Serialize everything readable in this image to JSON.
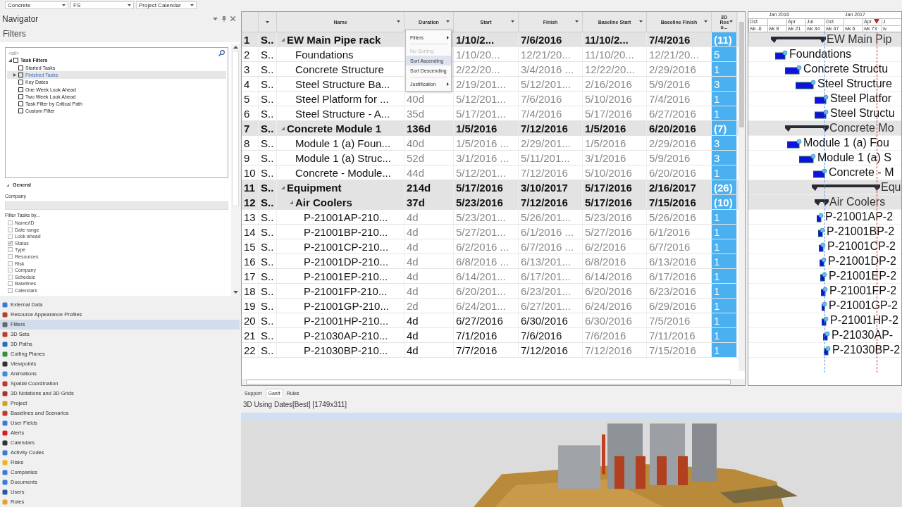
{
  "toolbar": {
    "dropdowns": [
      "Concrete",
      "FS",
      "Project Calendar"
    ]
  },
  "navigator": {
    "title": "Navigator",
    "section": "Filters",
    "filter_tree": {
      "placeholder": "<all>",
      "root": {
        "label": "Task Filters",
        "expanded": true,
        "checked": false,
        "children": [
          {
            "label": "Started Tasks",
            "checked": false,
            "selected": false
          },
          {
            "label": "Finished Tasks",
            "checked": false,
            "selected": true,
            "expanded": false
          },
          {
            "label": "Key Dates",
            "checked": false,
            "selected": false
          },
          {
            "label": "One Week Look Ahead",
            "checked": false,
            "selected": false
          },
          {
            "label": "Two Week Look Ahead",
            "checked": false,
            "selected": false
          },
          {
            "label": "Task Filter by Critical Path",
            "checked": false,
            "selected": false
          },
          {
            "label": "Custom Filter",
            "checked": false,
            "selected": false
          }
        ]
      }
    },
    "general": {
      "title": "General",
      "expanded": true,
      "company_label": "Company",
      "filter_by_label": "Filter Tasks by...",
      "options": [
        {
          "label": "Name/ID",
          "checked": false
        },
        {
          "label": "Date range",
          "checked": false
        },
        {
          "label": "Look ahead",
          "checked": false
        },
        {
          "label": "Status",
          "checked": true
        },
        {
          "label": "Type",
          "checked": false
        },
        {
          "label": "Resources",
          "checked": false
        },
        {
          "label": "Risk",
          "checked": false
        },
        {
          "label": "Company",
          "checked": false
        },
        {
          "label": "Schedule",
          "checked": false
        },
        {
          "label": "Baselines",
          "checked": false
        },
        {
          "label": "Calendars",
          "checked": false
        }
      ]
    },
    "items": [
      {
        "label": "External Data",
        "selected": false
      },
      {
        "label": "Resource Appearance Profiles",
        "selected": false
      },
      {
        "label": "Filters",
        "selected": true
      },
      {
        "label": "3D Sets",
        "selected": false
      },
      {
        "label": "3D Paths",
        "selected": false
      },
      {
        "label": "Cutting Planes",
        "selected": false
      },
      {
        "label": "Viewpoints",
        "selected": false
      },
      {
        "label": "Animations",
        "selected": false
      },
      {
        "label": "Spatial Coordination",
        "selected": false
      },
      {
        "label": "3D Notations and 3D Grids",
        "selected": false
      },
      {
        "label": "Project",
        "selected": false
      },
      {
        "label": "Baselines and Scenarios",
        "selected": false
      },
      {
        "label": "User Fields",
        "selected": false
      },
      {
        "label": "Alerts",
        "selected": false
      },
      {
        "label": "Calendars",
        "selected": false
      },
      {
        "label": "Activity Codes",
        "selected": false
      },
      {
        "label": "Risks",
        "selected": false
      },
      {
        "label": "Companies",
        "selected": false
      },
      {
        "label": "Documents",
        "selected": false
      },
      {
        "label": "Users",
        "selected": false
      },
      {
        "label": "Roles",
        "selected": false
      }
    ]
  },
  "table": {
    "columns": [
      "Name",
      "Duration",
      "Start",
      "Finish",
      "Baseline Start",
      "Baseline Finish",
      "3D Res o..."
    ],
    "rows": [
      {
        "kind": "summary",
        "number": "1",
        "code": "S..",
        "name": "EW Main Pipe rack",
        "start": "1/10/2...",
        "finish": "7/6/2016",
        "baseline_start": "11/10/2...",
        "baseline_finish": "7/4/2016",
        "resources": "(11)",
        "gantt_label": "EW Main Pip",
        "expanded": true,
        "children": [
          {
            "kind": "task",
            "dimmed": true,
            "number": "2",
            "code": "S..",
            "name": "Foundations",
            "start": "1/10/20...",
            "finish": "12/21/20...",
            "baseline_start": "11/10/20...",
            "baseline_finish": "12/21/20...",
            "resources": "5",
            "gantt_label": "Foundations"
          },
          {
            "kind": "task",
            "dimmed": true,
            "number": "3",
            "code": "S..",
            "name": "Concrete Structure",
            "start": "2/22/20...",
            "finish": "3/4/2016 ...",
            "baseline_start": "12/22/20...",
            "baseline_finish": "2/29/2016",
            "resources": "1",
            "gantt_label": "Concrete Structu"
          },
          {
            "kind": "task",
            "dimmed": true,
            "number": "4",
            "code": "S..",
            "name": "Steel Structure Ba...",
            "start": "2/19/201...",
            "finish": "5/12/201...",
            "baseline_start": "2/16/2016",
            "baseline_finish": "5/9/2016",
            "resources": "3",
            "gantt_label": "Steel Structure"
          },
          {
            "kind": "task",
            "dimmed": true,
            "number": "5",
            "code": "S..",
            "name": "Steel Platform for ...",
            "duration": "40d",
            "start": "5/12/201...",
            "finish": "7/6/2016",
            "baseline_start": "5/10/2016",
            "baseline_finish": "7/4/2016",
            "resources": "1",
            "gantt_label": "Steel Platfor"
          },
          {
            "kind": "task",
            "dimmed": true,
            "number": "6",
            "code": "S..",
            "name": "Steel Structure - A...",
            "duration": "35d",
            "start": "5/17/201...",
            "finish": "7/4/2016",
            "baseline_start": "5/17/2016",
            "baseline_finish": "6/27/2016",
            "resources": "1",
            "gantt_label": "Steel Structu"
          }
        ]
      },
      {
        "kind": "summary",
        "number": "7",
        "code": "S..",
        "name": "Concrete Module 1",
        "duration": "136d",
        "start": "1/5/2016",
        "finish": "7/12/2016",
        "baseline_start": "1/5/2016",
        "baseline_finish": "6/20/2016",
        "resources": "(7)",
        "gantt_label": "Concrete Mo",
        "expanded": true,
        "children": [
          {
            "kind": "task",
            "dimmed": true,
            "number": "8",
            "code": "S..",
            "name": "Module 1 (a) Foun...",
            "duration": "40d",
            "start": "1/5/2016 ...",
            "finish": "2/29/201...",
            "baseline_start": "1/5/2016",
            "baseline_finish": "2/29/2016",
            "resources": "3",
            "gantt_label": "Module 1 (a) Fou"
          },
          {
            "kind": "task",
            "dimmed": true,
            "number": "9",
            "code": "S..",
            "name": "Module 1 (a) Struc...",
            "duration": "52d",
            "start": "3/1/2016 ...",
            "finish": "5/11/201...",
            "baseline_start": "3/1/2016",
            "baseline_finish": "5/9/2016",
            "resources": "3",
            "gantt_label": "Module 1 (a) S"
          },
          {
            "kind": "task",
            "dimmed": true,
            "number": "10",
            "code": "S..",
            "name": "Concrete - Module...",
            "duration": "44d",
            "start": "5/12/201...",
            "finish": "7/12/2016",
            "baseline_start": "5/10/2016",
            "baseline_finish": "6/20/2016",
            "resources": "1",
            "gantt_label": "Concrete - M"
          }
        ]
      },
      {
        "kind": "summary",
        "number": "11",
        "code": "S..",
        "name": "Equipment",
        "duration": "214d",
        "start": "5/17/2016",
        "finish": "3/10/2017",
        "baseline_start": "5/17/2016",
        "baseline_finish": "2/16/2017",
        "resources": "(26)",
        "gantt_label": "Equ",
        "expanded": true,
        "children": [
          {
            "kind": "summary",
            "number": "12",
            "code": "S..",
            "name": "Air Coolers",
            "duration": "37d",
            "start": "5/23/2016",
            "finish": "7/12/2016",
            "baseline_start": "5/17/2016",
            "baseline_finish": "7/15/2016",
            "resources": "(10)",
            "gantt_label": "Air Coolers",
            "expanded": true,
            "children": [
              {
                "kind": "task",
                "dimmed": true,
                "number": "13",
                "code": "S..",
                "name": "P-21001AP-210...",
                "duration": "4d",
                "start": "5/23/201...",
                "finish": "5/26/201...",
                "baseline_start": "5/23/2016",
                "baseline_finish": "5/26/2016",
                "resources": "1",
                "gantt_label": "P-21001AP-2"
              },
              {
                "kind": "task",
                "dimmed": true,
                "number": "14",
                "code": "S..",
                "name": "P-21001BP-210...",
                "duration": "4d",
                "start": "5/27/201...",
                "finish": "6/1/2016 ...",
                "baseline_start": "5/27/2016",
                "baseline_finish": "6/1/2016",
                "resources": "1",
                "gantt_label": "P-21001BP-2"
              },
              {
                "kind": "task",
                "dimmed": true,
                "number": "15",
                "code": "S..",
                "name": "P-21001CP-210...",
                "duration": "4d",
                "start": "6/2/2016 ...",
                "finish": "6/7/2016 ...",
                "baseline_start": "6/2/2016",
                "baseline_finish": "6/7/2016",
                "resources": "1",
                "gantt_label": "P-21001CP-2"
              },
              {
                "kind": "task",
                "dimmed": true,
                "number": "16",
                "code": "S..",
                "name": "P-21001DP-210...",
                "duration": "4d",
                "start": "6/8/2016 ...",
                "finish": "6/13/201...",
                "baseline_start": "6/8/2016",
                "baseline_finish": "6/13/2016",
                "resources": "1",
                "gantt_label": "P-21001DP-2"
              },
              {
                "kind": "task",
                "dimmed": true,
                "number": "17",
                "code": "S..",
                "name": "P-21001EP-210...",
                "duration": "4d",
                "start": "6/14/201...",
                "finish": "6/17/201...",
                "baseline_start": "6/14/2016",
                "baseline_finish": "6/17/2016",
                "resources": "1",
                "gantt_label": "P-21001EP-2"
              },
              {
                "kind": "task",
                "dimmed": true,
                "number": "18",
                "code": "S..",
                "name": "P-21001FP-210...",
                "duration": "4d",
                "start": "6/20/201...",
                "finish": "6/23/201...",
                "baseline_start": "6/20/2016",
                "baseline_finish": "6/23/2016",
                "resources": "1",
                "gantt_label": "P-21001FP-2"
              },
              {
                "kind": "task",
                "dimmed": true,
                "number": "19",
                "code": "S..",
                "name": "P-21001GP-210...",
                "duration": "2d",
                "start": "6/24/201...",
                "finish": "6/27/201...",
                "baseline_start": "6/24/2016",
                "baseline_finish": "6/29/2016",
                "resources": "1",
                "gantt_label": "P-21001GP-2"
              },
              {
                "kind": "task",
                "dimmed": false,
                "number": "20",
                "code": "S..",
                "name": "P-21001HP-210...",
                "duration": "4d",
                "start": "6/27/2016",
                "finish": "6/30/2016",
                "baseline_start": "6/30/2016",
                "baseline_finish": "7/5/2016",
                "resources": "1",
                "gantt_label": "P-21001HP-2"
              },
              {
                "kind": "task",
                "dimmed": false,
                "number": "21",
                "code": "S..",
                "name": "P-21030AP-210...",
                "duration": "4d",
                "start": "7/1/2016",
                "finish": "7/6/2016",
                "baseline_start": "7/6/2016",
                "baseline_finish": "7/11/2016",
                "resources": "1",
                "gantt_label": "P-21030AP-"
              },
              {
                "kind": "task",
                "dimmed": false,
                "number": "22",
                "code": "S..",
                "name": "P-21030BP-210...",
                "duration": "4d",
                "start": "7/7/2016",
                "finish": "7/12/2016",
                "baseline_start": "7/12/2016",
                "baseline_finish": "7/15/2016",
                "resources": "1",
                "gantt_label": "P-21030BP-2"
              }
            ]
          }
        ]
      }
    ]
  },
  "context_menu": {
    "items": [
      {
        "label": "Filters",
        "submenu": true,
        "disabled": false,
        "hovered": false
      },
      {
        "label": "No Sorting",
        "submenu": false,
        "disabled": true,
        "hovered": false
      },
      {
        "label": "Sort Ascending",
        "submenu": false,
        "disabled": false,
        "hovered": true
      },
      {
        "label": "Sort Descending",
        "submenu": false,
        "disabled": false,
        "hovered": false
      },
      {
        "label": "Justification",
        "submenu": true,
        "disabled": false,
        "hovered": false
      }
    ]
  },
  "gantt": {
    "years": [
      {
        "label": "Jan 2016"
      },
      {
        "label": "Jan 2017"
      }
    ],
    "columns": [
      {
        "month": "Oct",
        "week": "wk -6"
      },
      {
        "week": "wk 8"
      },
      {
        "month": "Apr",
        "week": "wk 21"
      },
      {
        "month": "Jul",
        "week": "wk 34"
      },
      {
        "month": "Oct",
        "week": "wk 47"
      },
      {
        "week": "wk 6"
      },
      {
        "month": "Apr",
        "week": "wk 73"
      },
      {
        "month": "J",
        "week": "w"
      }
    ]
  },
  "bottom_tabs": [
    {
      "label": "Support",
      "selected": false
    },
    {
      "label": "Gantt",
      "selected": true
    },
    {
      "label": "Rules",
      "selected": false
    }
  ],
  "view": {
    "title": "3D Using Dates[Best] [1749x311]",
    "kind": "picture"
  }
}
